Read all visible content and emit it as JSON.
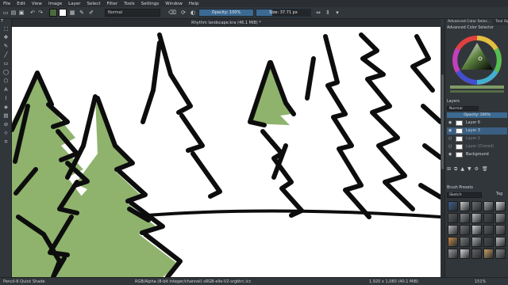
{
  "menubar": {
    "items": [
      "File",
      "Edit",
      "View",
      "Image",
      "Layer",
      "Select",
      "Filter",
      "Tools",
      "Settings",
      "Window",
      "Help"
    ]
  },
  "toolbar": {
    "blend_mode": "Normal",
    "opacity_label": "Opacity: 100%",
    "opacity_value": 1.0,
    "size_label": "Size: 37.71 px",
    "size_fraction": 0.3,
    "fg_color": "#4c6a3e",
    "bg_color": "#ffffff"
  },
  "document": {
    "tab_title": "Rhythm landscape.kra (46.1 MiB) *"
  },
  "canvas": {
    "tree_fill_color": "#8fb36d",
    "ink_color": "#0d0d0d",
    "paper_color": "#ffffff"
  },
  "left_tools": {
    "label": "T",
    "icons": [
      "select-icon",
      "transform-icon",
      "brush-icon",
      "line-icon",
      "rectangle-icon",
      "ellipse-icon",
      "polygon-icon",
      "text-icon",
      "path-icon",
      "fill-icon",
      "gradient-icon",
      "eyedropper-icon",
      "assistant-icon",
      "crop-icon"
    ]
  },
  "dock": {
    "tabs": [
      "Advanced Color Selec...",
      "Tool Options"
    ],
    "color_selector_title": "Advanced Color Selector",
    "layers_title": "Layers",
    "layers_blend": "Normal",
    "layers_opacity": "Opacity:  100%",
    "layers": [
      {
        "name": "Layer 6",
        "visible": true,
        "selected": false,
        "dim": false
      },
      {
        "name": "Layer 3",
        "visible": true,
        "selected": true,
        "dim": false
      },
      {
        "name": "Layer 2",
        "visible": false,
        "selected": false,
        "dim": true
      },
      {
        "name": "Layer (Cloned)",
        "visible": false,
        "selected": false,
        "dim": true
      },
      {
        "name": "Background",
        "visible": true,
        "selected": false,
        "dim": false
      }
    ],
    "presets_title": "Brush Presets",
    "presets_tag": "Sketch",
    "presets_search": "Tag",
    "preset_colors": [
      "#3b5f8a",
      "#c9c9c9",
      "#6d6d6d",
      "#a0a0a0",
      "#d8d8d8",
      "#5a5a5a",
      "#8a8a8a",
      "#c0c0c0",
      "#4c4c4c",
      "#9e9e9e",
      "#b5b5b5",
      "#727272",
      "#d0d0d0",
      "#5f5f5f",
      "#888888",
      "#c48a4a",
      "#7a7a7a",
      "#aaaaaa",
      "#4a4a4a",
      "#bcbcbc",
      "#9a9a9a",
      "#d6d6d6",
      "#636363",
      "#c8a060",
      "#868686"
    ]
  },
  "status": {
    "brush": "Pencil-6 Quick Shade",
    "color_space": "RGB/Alpha (8-bit integer/channel)  sRGB-elle-V2-srgbtrc.icc",
    "image_size": "1,920 x 1,080 (40.1 MiB)",
    "zoom": "151%"
  }
}
